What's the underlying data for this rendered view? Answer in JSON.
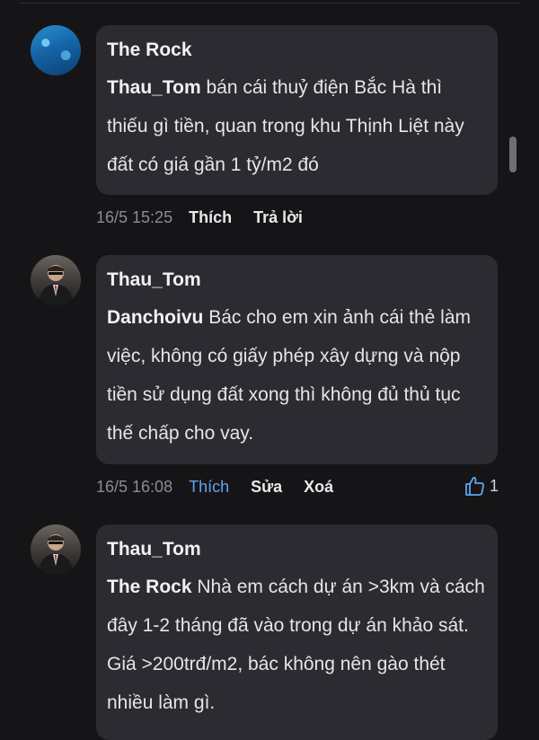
{
  "comments": [
    {
      "author": "The Rock",
      "mention": "Thau_Tom",
      "text": " bán cái thuỷ điện Bắc Hà thì thiếu gì tiền, quan trong khu Thịnh Liệt này đất có giá gần 1 tỷ/m2 đó",
      "time": "16/5 15:25",
      "actions": [
        "Thích",
        "Trả lời"
      ],
      "avatar": "ocean-avatar"
    },
    {
      "author": "Thau_Tom",
      "mention": "Danchoivu",
      "text": " Bác cho em xin ảnh cái thẻ làm việc, không có giấy phép xây dựng và nộp tiền sử dụng đất xong thì không đủ thủ tục thế chấp cho vay.",
      "time": "16/5 16:08",
      "actions": [
        "Thích",
        "Sửa",
        "Xoá"
      ],
      "likes": "1",
      "avatar": "man-in-suit-avatar"
    },
    {
      "author": "Thau_Tom",
      "mention": "The Rock",
      "text": " Nhà em cách dự án >3km và cách đây 1-2 tháng đã vào trong dự án khảo sát. Giá >200trđ/m2, bác không nên gào thét nhiều làm gì.",
      "avatar": "man-in-suit-avatar"
    }
  ],
  "colors": {
    "background": "#151517",
    "bubble": "#2b2b31",
    "liked": "#5aa8f0"
  }
}
